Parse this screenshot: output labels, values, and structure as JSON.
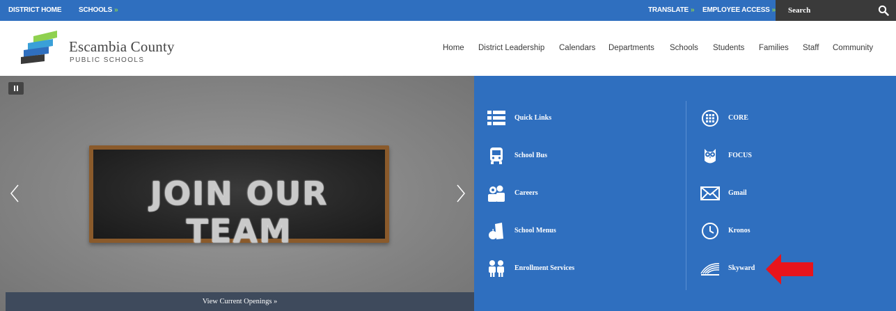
{
  "topbar": {
    "district_home": "DISTRICT HOME",
    "schools": "SCHOOLS",
    "translate": "TRANSLATE",
    "employee_access": "EMPLOYEE ACCESS",
    "dropdown_marker": "»",
    "search_label": "Search"
  },
  "header": {
    "logo_name": "Escambia County",
    "logo_sub": "PUBLIC SCHOOLS",
    "nav": [
      "Home",
      "District Leadership",
      "Calendars",
      "Departments",
      "Schools",
      "Students",
      "Families",
      "Staff",
      "Community"
    ]
  },
  "hero": {
    "slide_text": "JOIN OUR TEAM",
    "cta": "View Current Openings »"
  },
  "quick_links": {
    "left": [
      {
        "label": "Quick Links",
        "icon": "list-icon"
      },
      {
        "label": "School Bus",
        "icon": "bus-icon"
      },
      {
        "label": "Careers",
        "icon": "people-icon"
      },
      {
        "label": "School Menus",
        "icon": "apple-icon"
      },
      {
        "label": "Enrollment Services",
        "icon": "students-icon"
      }
    ],
    "right": [
      {
        "label": "CORE",
        "icon": "grid-circle-icon"
      },
      {
        "label": "FOCUS",
        "icon": "owl-icon"
      },
      {
        "label": "Gmail",
        "icon": "envelope-icon"
      },
      {
        "label": "Kronos",
        "icon": "clock-icon"
      },
      {
        "label": "Skyward",
        "icon": "skyward-logo-icon"
      }
    ]
  },
  "colors": {
    "primary_blue": "#2f6fbf",
    "accent_green": "#8fd14f",
    "annotation_red": "#e8141b"
  }
}
